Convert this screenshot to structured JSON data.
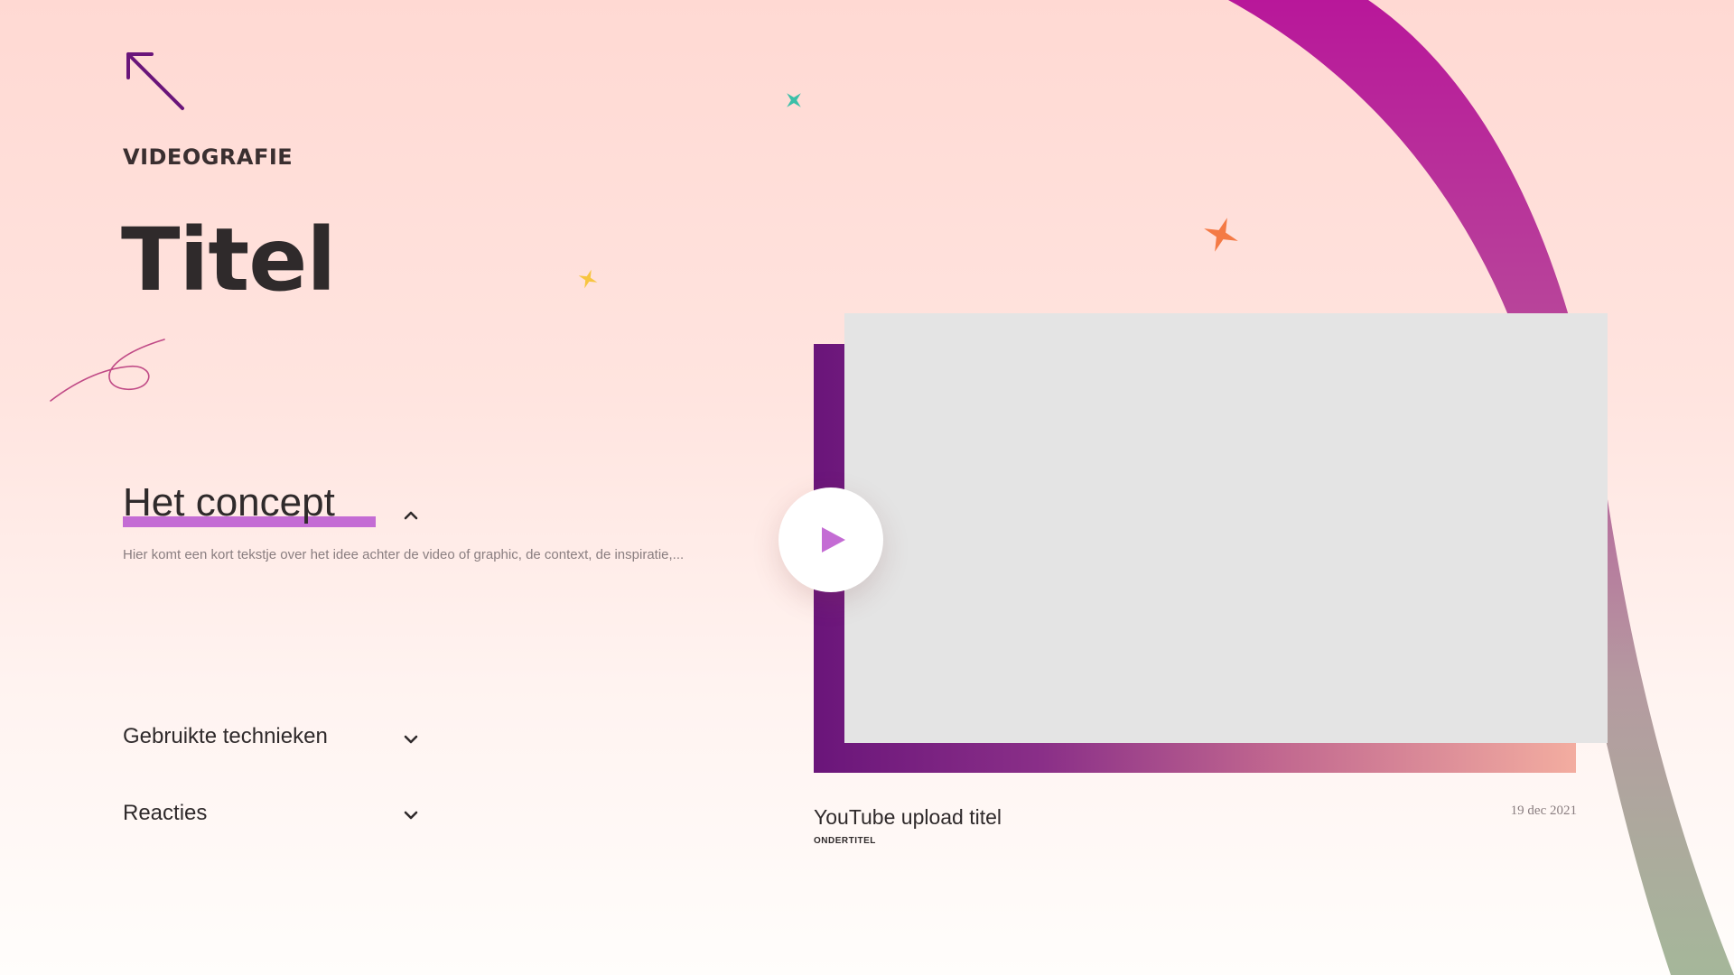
{
  "header": {
    "section_label": "VIDEOGRAFIE",
    "title": "Titel"
  },
  "accordion": {
    "concept": {
      "title": "Het concept",
      "text": "Hier komt een kort tekstje over het idee achter de video of graphic, de context, de inspiratie,...",
      "expanded": true
    },
    "techniques": {
      "title": "Gebruikte technieken",
      "expanded": false
    },
    "reactions": {
      "title": "Reacties",
      "expanded": false
    }
  },
  "video": {
    "title": "YouTube upload titel",
    "subtitle": "ONDERTITEL",
    "date": "19 dec 2021"
  },
  "colors": {
    "accent_purple": "#c46cd4",
    "deep_purple": "#6a157a",
    "arc_top": "#b8179a",
    "arc_bottom": "#a5b79a",
    "sparkle_teal": "#3bbfa8",
    "sparkle_yellow": "#f7c541",
    "sparkle_orange": "#f47a45"
  }
}
